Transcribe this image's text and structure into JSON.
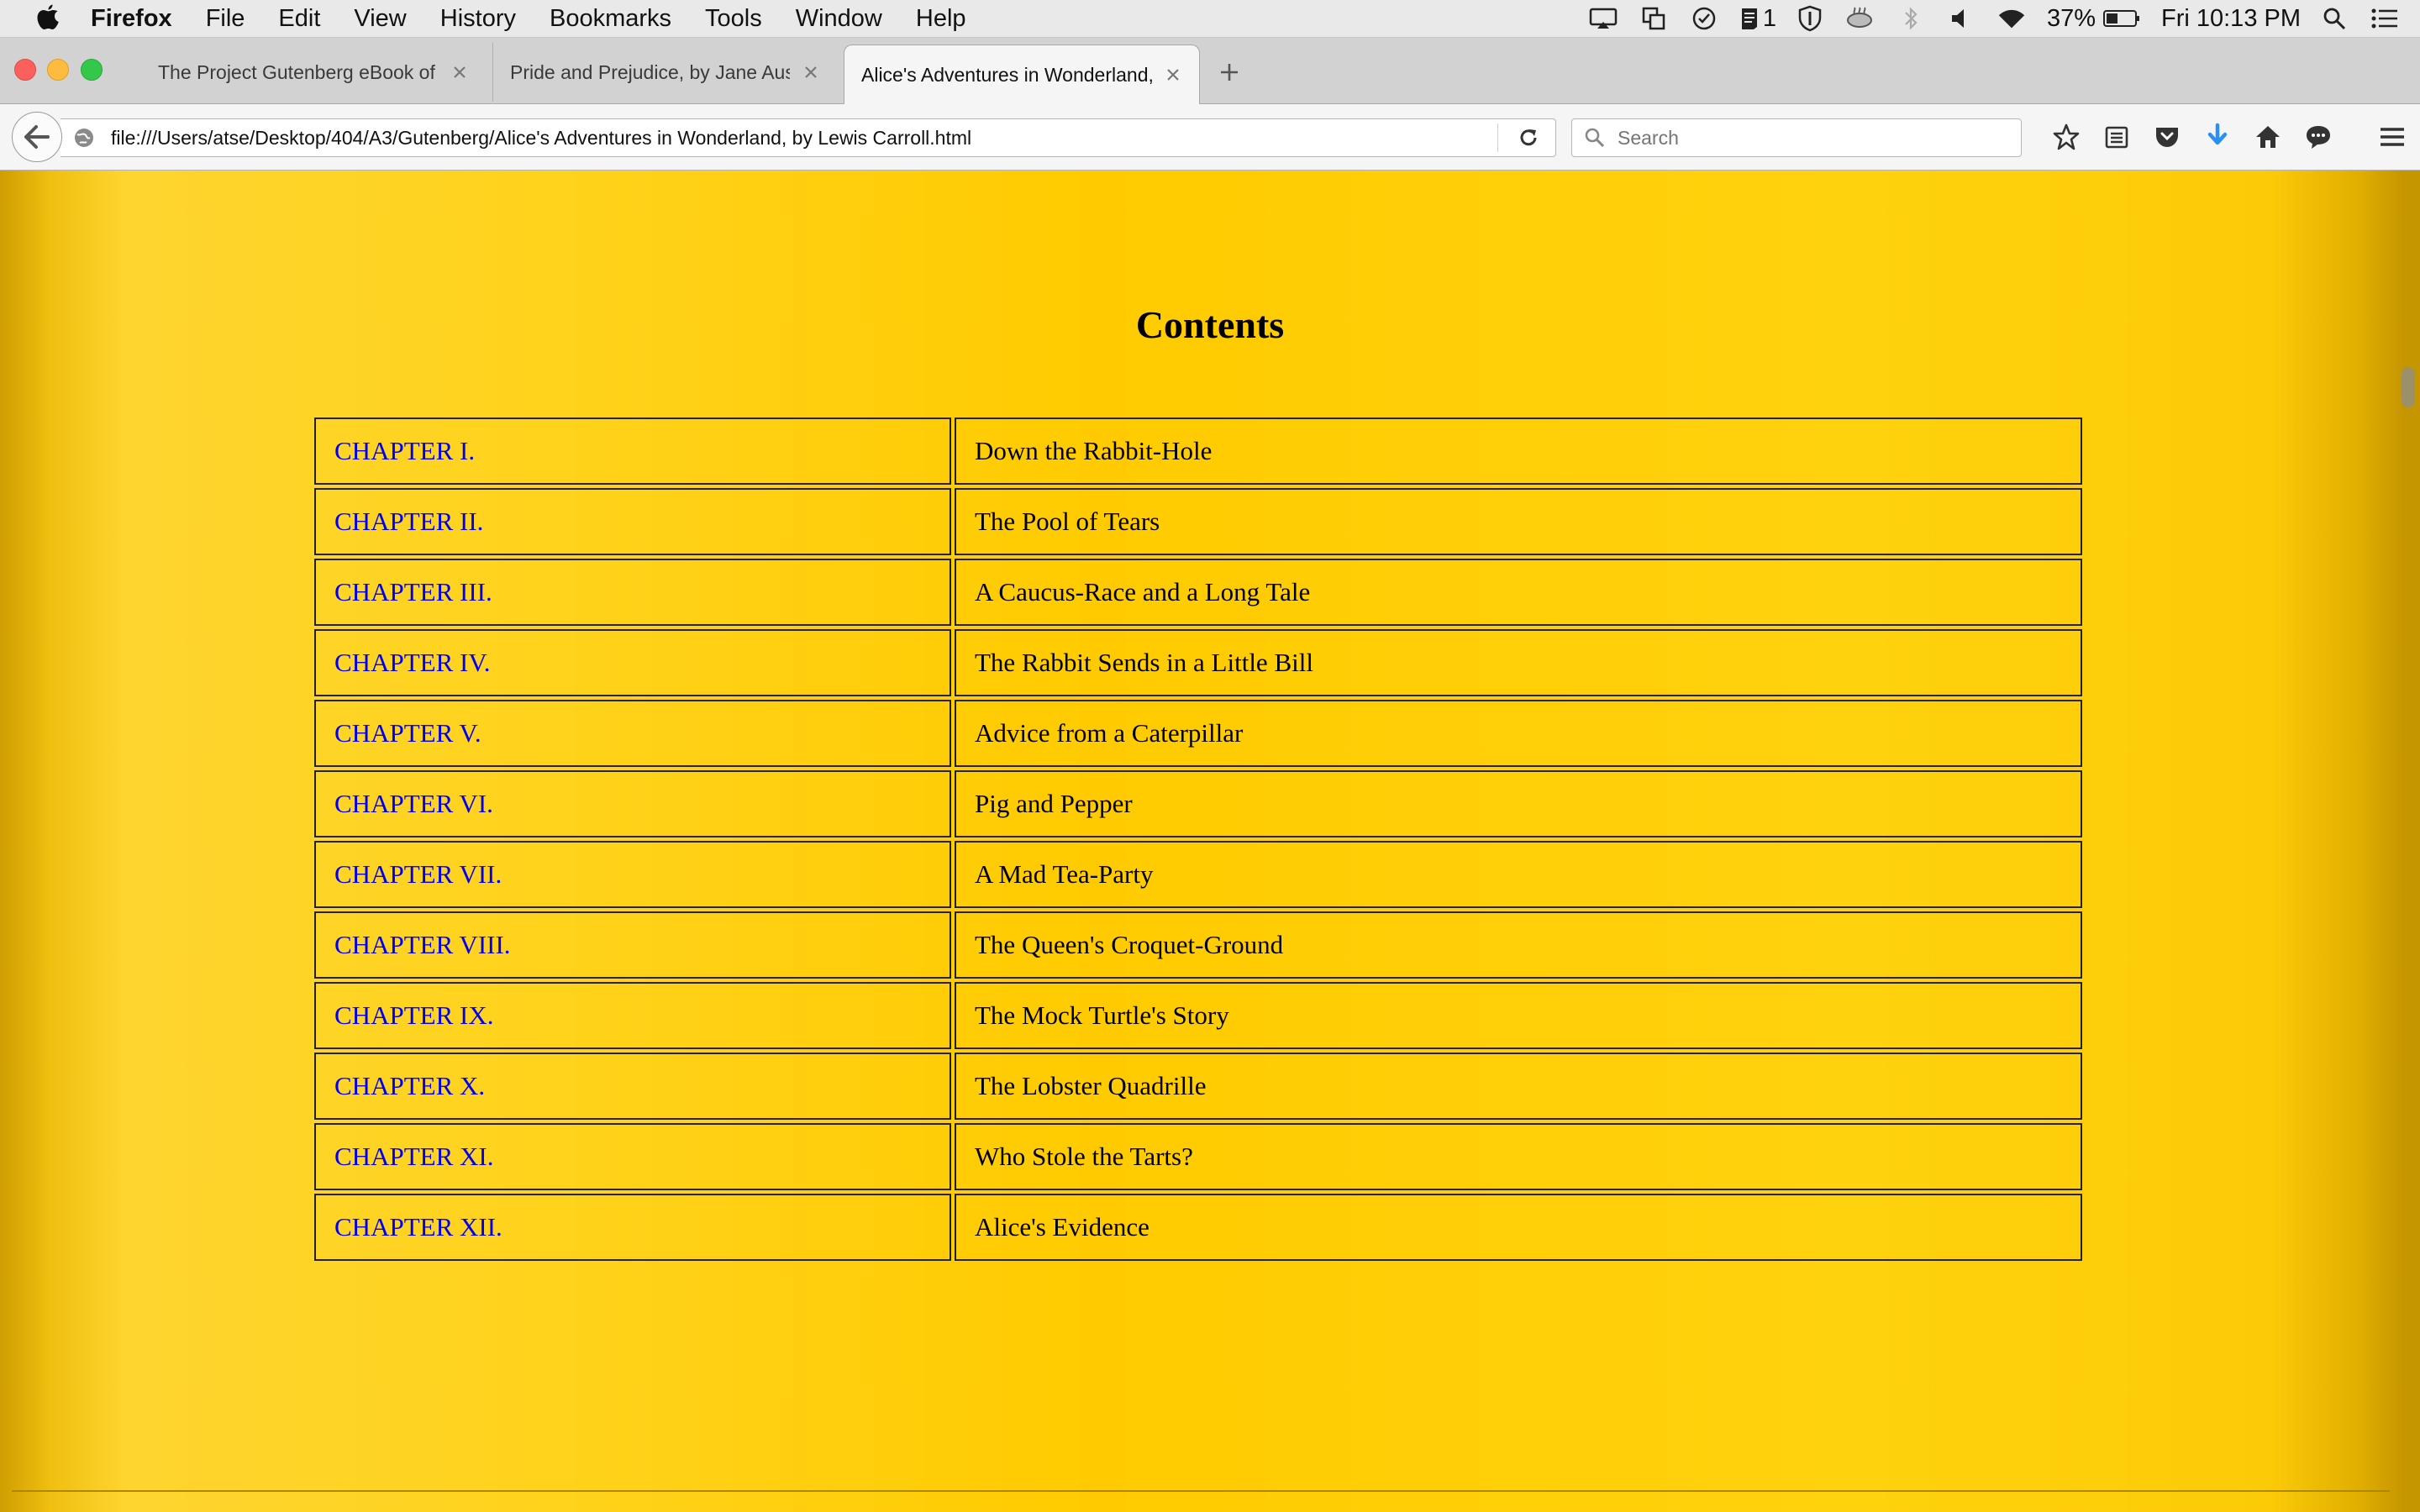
{
  "menubar": {
    "app_name": "Firefox",
    "items": [
      "File",
      "Edit",
      "View",
      "History",
      "Bookmarks",
      "Tools",
      "Window",
      "Help"
    ],
    "badge_count": "1",
    "battery": "37%",
    "clock": "Fri 10:13 PM"
  },
  "tabs": [
    {
      "label": "The Project Gutenberg eBook of D..."
    },
    {
      "label": "Pride and Prejudice, by Jane Austen"
    },
    {
      "label": "Alice's Adventures in Wonderland, ..."
    }
  ],
  "navbar": {
    "url": "file:///Users/atse/Desktop/404/A3/Gutenberg/Alice's Adventures in Wonderland, by Lewis Carroll.html",
    "search_placeholder": "Search"
  },
  "page": {
    "title": "Contents",
    "chapters": [
      {
        "label": "CHAPTER I.",
        "title": "Down the Rabbit-Hole"
      },
      {
        "label": "CHAPTER II.",
        "title": "The Pool of Tears"
      },
      {
        "label": "CHAPTER III.",
        "title": "A Caucus-Race and a Long Tale"
      },
      {
        "label": "CHAPTER IV.",
        "title": "The Rabbit Sends in a Little Bill"
      },
      {
        "label": "CHAPTER V.",
        "title": "Advice from a Caterpillar"
      },
      {
        "label": "CHAPTER VI.",
        "title": "Pig and Pepper"
      },
      {
        "label": "CHAPTER VII.",
        "title": "A Mad Tea-Party"
      },
      {
        "label": "CHAPTER VIII.",
        "title": "The Queen's Croquet-Ground"
      },
      {
        "label": "CHAPTER IX.",
        "title": "The Mock Turtle's Story"
      },
      {
        "label": "CHAPTER X.",
        "title": "The Lobster Quadrille"
      },
      {
        "label": "CHAPTER XI.",
        "title": "Who Stole the Tarts?"
      },
      {
        "label": "CHAPTER XII.",
        "title": "Alice's Evidence"
      }
    ]
  },
  "colors": {
    "link": "#0000ee",
    "page_background": "#ffcc00",
    "download_accent": "#2a90f5"
  }
}
